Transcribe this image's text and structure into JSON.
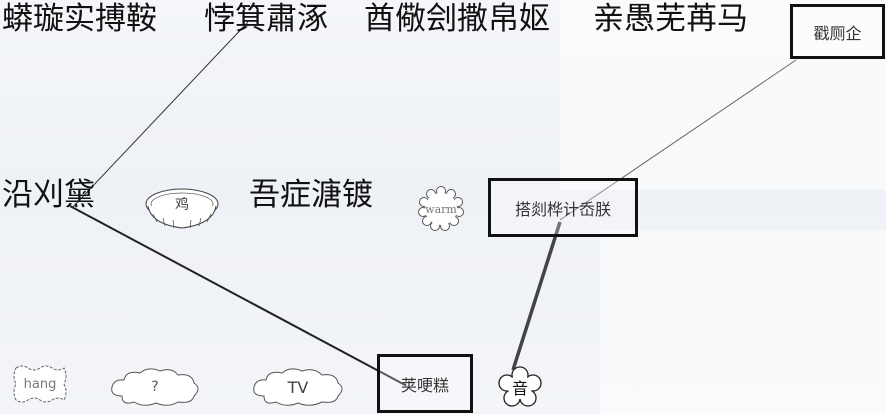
{
  "top_words": [
    "蟒璇实搏鞍",
    "悖箕肅涿",
    "酋儆刽撒帛妪",
    "亲愚芜苒马"
  ],
  "mid_words": [
    "沿刈黛",
    "吾症溏镀"
  ],
  "boxes": {
    "top_right": "戳厕企",
    "middle": "搭剡桦计岙朕",
    "bottom": "荚哽糕"
  },
  "shapes": {
    "pie": "鸡",
    "warm": "warm",
    "hang": "hang",
    "question": "?",
    "tv": "TV",
    "flower": "音"
  }
}
